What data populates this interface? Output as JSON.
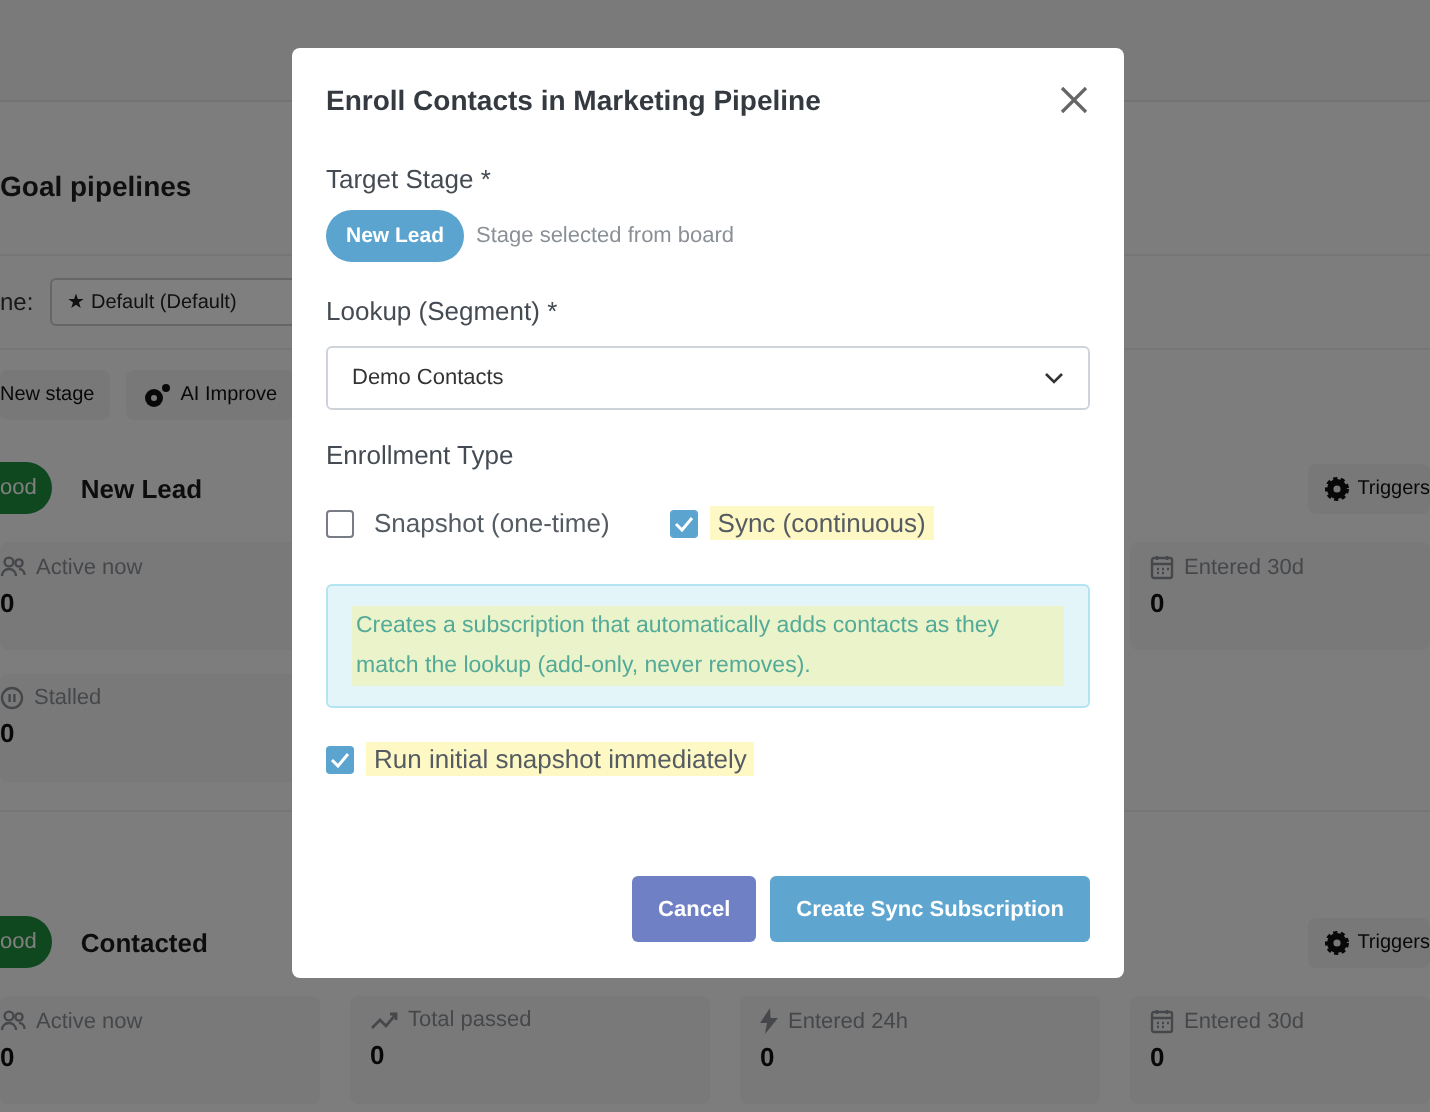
{
  "page": {
    "title": "Goal pipelines",
    "pipeline_label": "ne:",
    "pipeline_select": "★ Default (Default)",
    "actions": [
      {
        "label": "New stage",
        "kind": "plain"
      },
      {
        "label": "AI Improve",
        "kind": "ai"
      }
    ],
    "stages": [
      {
        "badge": "ood",
        "name": "New Lead",
        "triggers": "Triggers",
        "stat_rows": [
          [
            {
              "kind": "active",
              "label": "Active now",
              "value": "0"
            },
            null,
            null,
            {
              "kind": "monthly",
              "label": "Entered 30d",
              "value": "0"
            }
          ],
          [
            {
              "kind": "stalled",
              "label": "Stalled",
              "value": "0"
            }
          ]
        ]
      },
      {
        "badge": "ood",
        "name": "Contacted",
        "triggers": "Triggers",
        "stat_rows": [
          [
            {
              "kind": "active",
              "label": "Active now",
              "value": "0"
            },
            {
              "kind": "passed",
              "label": "Total passed",
              "value": "0"
            },
            {
              "kind": "daily",
              "label": "Entered 24h",
              "value": "0"
            },
            {
              "kind": "monthly",
              "label": "Entered 30d",
              "value": "0"
            }
          ]
        ]
      }
    ]
  },
  "dialog": {
    "title": "Enroll Contacts in Marketing Pipeline",
    "target_label": "Target Stage *",
    "stage_chip": "New Lead",
    "stage_note": "Stage selected from board",
    "lookup_label": "Lookup (Segment) *",
    "lookup_value": "Demo Contacts",
    "type_label": "Enrollment Type",
    "types": [
      {
        "label": "Snapshot (one-time)",
        "checked": false,
        "highlighted": false
      },
      {
        "label": "Sync (continuous)",
        "checked": true,
        "highlighted": true
      }
    ],
    "info": {
      "text": "Creates a subscription that automatically adds contacts as they match the lookup (add-only, never removes).",
      "highlighted": true
    },
    "run_now": {
      "label": "Run initial snapshot immediately",
      "checked": true,
      "highlighted": true
    },
    "buttons": [
      {
        "label": "Cancel",
        "kind": "secondary"
      },
      {
        "label": "Create Sync Subscription",
        "kind": "primary"
      }
    ]
  }
}
